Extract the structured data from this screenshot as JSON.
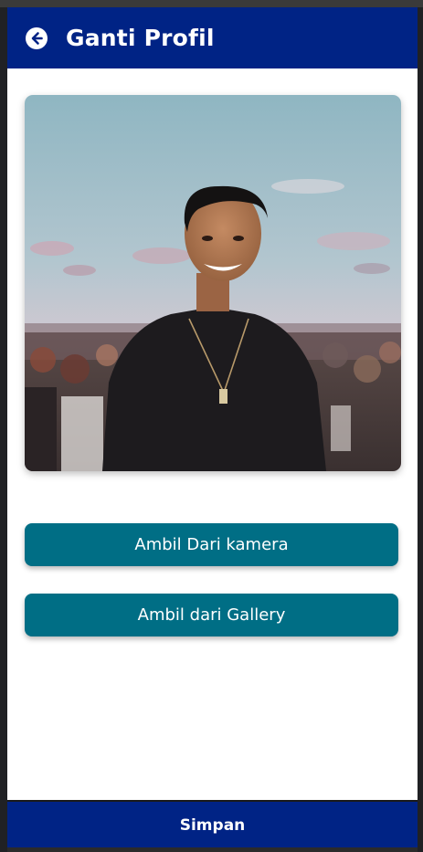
{
  "appbar": {
    "title": "Ganti Profil",
    "back_icon": "arrow-left-circle-icon",
    "background_color": "#002385"
  },
  "profile_photo": {
    "description_icon": "profile-photo"
  },
  "actions": {
    "camera_label": "Ambil Dari kamera",
    "gallery_label": "Ambil dari Gallery",
    "button_color": "#006e85"
  },
  "footer": {
    "save_label": "Simpan",
    "background_color": "#002385"
  }
}
